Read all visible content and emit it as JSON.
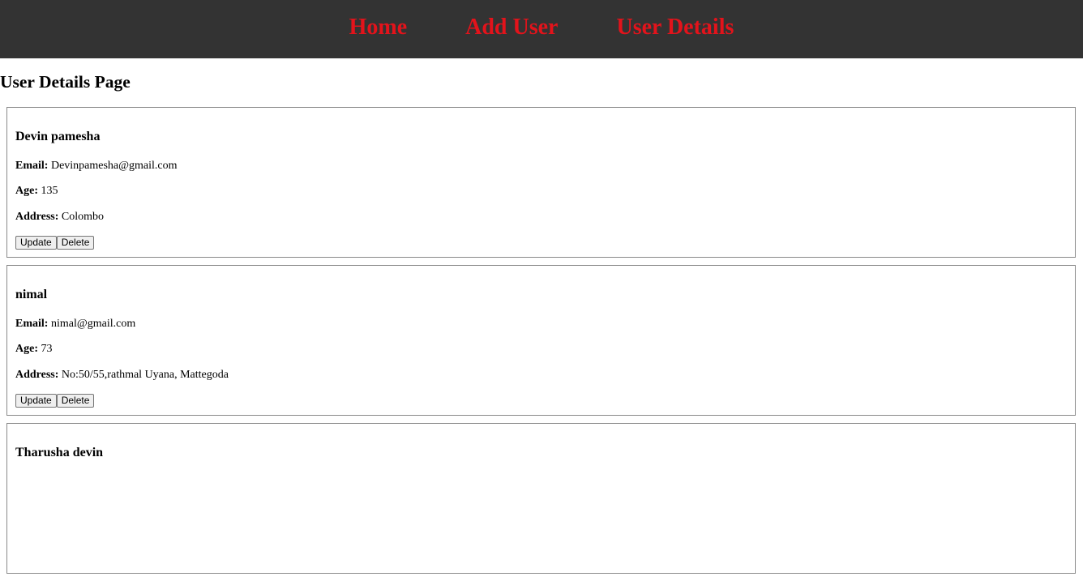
{
  "nav": {
    "home": "Home",
    "add_user": "Add User",
    "user_details": "User Details"
  },
  "page": {
    "title": "User Details Page"
  },
  "labels": {
    "email": "Email:",
    "age": "Age:",
    "address": "Address:",
    "update": "Update",
    "delete": "Delete"
  },
  "users": [
    {
      "name": "Devin pamesha",
      "email": "Devinpamesha@gmail.com",
      "age": "135",
      "address": "Colombo"
    },
    {
      "name": "nimal",
      "email": "nimal@gmail.com",
      "age": "73",
      "address": "No:50/55,rathmal Uyana, Mattegoda"
    },
    {
      "name": "Tharusha devin"
    }
  ],
  "colors": {
    "navbar_bg": "#333333",
    "nav_link": "#e3131b"
  }
}
